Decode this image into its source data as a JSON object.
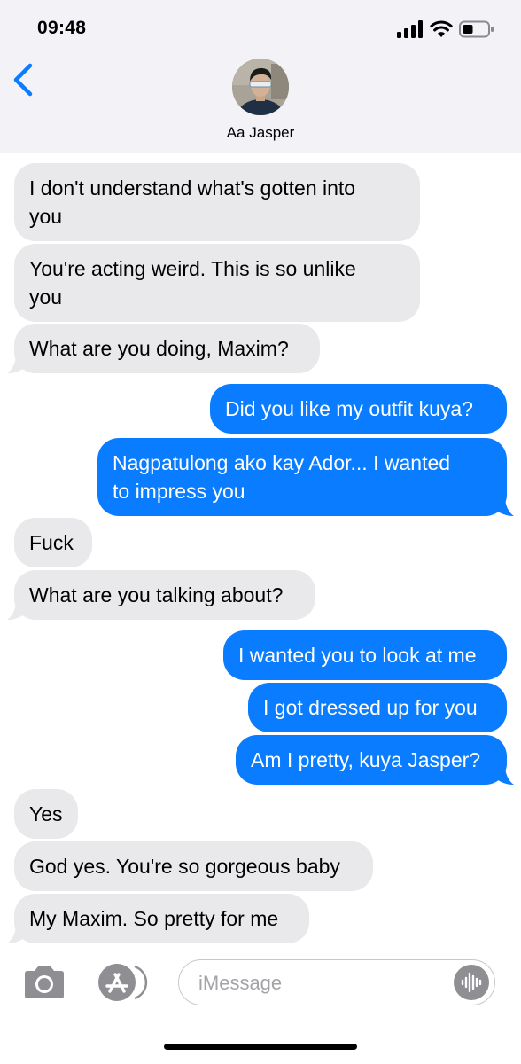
{
  "status_bar": {
    "time": "09:48",
    "icons": [
      "signal-icon",
      "wifi-icon",
      "battery-icon"
    ]
  },
  "header": {
    "contact_name": "Aa Jasper",
    "back_icon": "chevron-left-icon"
  },
  "messages": [
    {
      "direction": "incoming",
      "lines": [
        "I don't understand what's gotten into",
        "you"
      ]
    },
    {
      "direction": "incoming",
      "lines": [
        "You're acting weird. This is so unlike",
        "you"
      ]
    },
    {
      "direction": "incoming",
      "lines": [
        "What are you doing, Maxim?"
      ]
    },
    {
      "direction": "outgoing",
      "lines": [
        "Did you like my outfit kuya?"
      ]
    },
    {
      "direction": "outgoing",
      "lines": [
        "Nagpatulong ako kay Ador... I wanted",
        "to impress you"
      ]
    },
    {
      "direction": "incoming",
      "lines": [
        "Fuck"
      ]
    },
    {
      "direction": "incoming",
      "lines": [
        "What are you talking about?"
      ]
    },
    {
      "direction": "outgoing",
      "lines": [
        "I wanted you to look at me"
      ]
    },
    {
      "direction": "outgoing",
      "lines": [
        "I got dressed up for you"
      ]
    },
    {
      "direction": "outgoing",
      "lines": [
        "Am I pretty, kuya Jasper?"
      ]
    },
    {
      "direction": "incoming",
      "lines": [
        "Yes"
      ]
    },
    {
      "direction": "incoming",
      "lines": [
        "God yes. You're so gorgeous baby"
      ]
    },
    {
      "direction": "incoming",
      "lines": [
        "My Maxim. So pretty for me"
      ]
    }
  ],
  "input_bar": {
    "placeholder": "iMessage",
    "icons": [
      "camera-icon",
      "app-store-icon",
      "audio-waveform-icon"
    ]
  },
  "colors": {
    "outgoing_bubble": "#0a7cff",
    "incoming_bubble": "#e9e9eb",
    "accent": "#0a7cff",
    "header_background": "#f2f2f7"
  }
}
